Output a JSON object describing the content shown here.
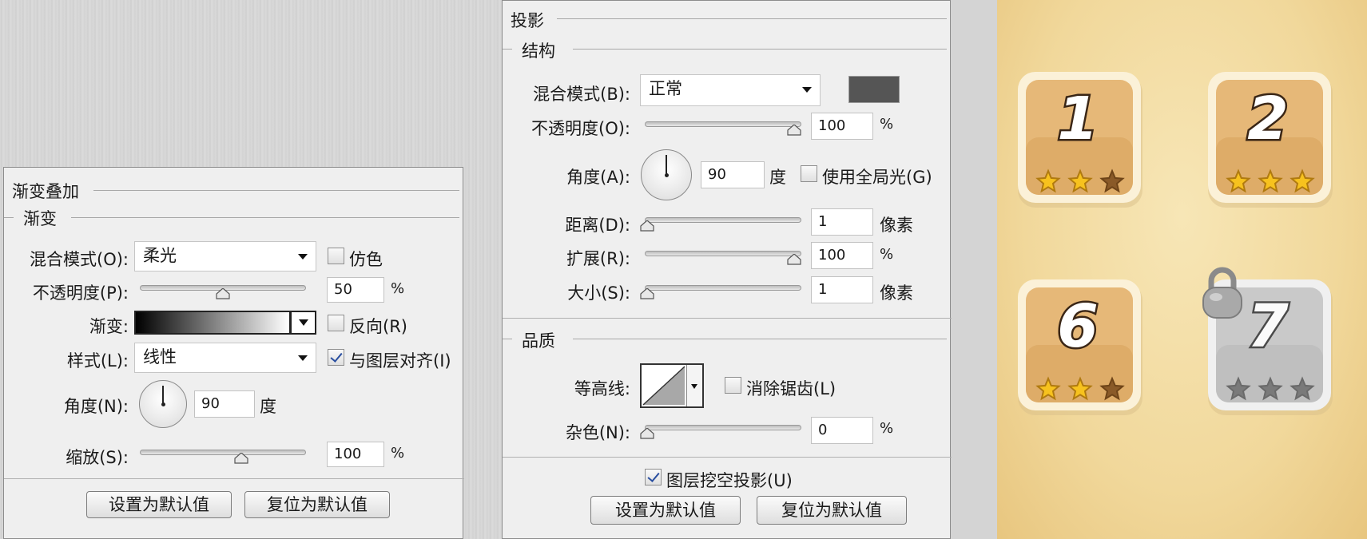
{
  "gradient_panel": {
    "section_title": "渐变叠加",
    "sub_title": "渐变",
    "blend_mode": {
      "label": "混合模式(O):",
      "value": "柔光"
    },
    "dither": {
      "label": "仿色",
      "checked": false
    },
    "opacity": {
      "label": "不透明度(P):",
      "value": "50",
      "unit": "%",
      "level": 0.5
    },
    "gradient": {
      "label": "渐变:"
    },
    "reverse": {
      "label": "反向(R)",
      "checked": false
    },
    "style": {
      "label": "样式(L):",
      "value": "线性"
    },
    "align": {
      "label": "与图层对齐(I)",
      "checked": true
    },
    "angle": {
      "label": "角度(N):",
      "value": "90",
      "unit": "度"
    },
    "scale": {
      "label": "缩放(S):",
      "value": "100",
      "unit": "%",
      "level": 0.6
    },
    "set_default": "设置为默认值",
    "reset_default": "复位为默认值"
  },
  "shadow_panel": {
    "section_title": "投影",
    "structure_title": "结构",
    "blend_mode": {
      "label": "混合模式(B):",
      "value": "正常",
      "color": "#555555"
    },
    "opacity": {
      "label": "不透明度(O):",
      "value": "100",
      "unit": "%",
      "level": 1.0
    },
    "angle": {
      "label": "角度(A):",
      "value": "90",
      "unit": "度"
    },
    "global_light": {
      "label": "使用全局光(G)",
      "checked": false
    },
    "distance": {
      "label": "距离(D):",
      "value": "1",
      "unit": "像素",
      "level": 0.0
    },
    "spread": {
      "label": "扩展(R):",
      "value": "100",
      "unit": "%",
      "level": 1.0
    },
    "size": {
      "label": "大小(S):",
      "value": "1",
      "unit": "像素",
      "level": 0.0
    },
    "quality_title": "品质",
    "contour": {
      "label": "等高线:"
    },
    "anti_alias": {
      "label": "消除锯齿(L)",
      "checked": false
    },
    "noise": {
      "label": "杂色(N):",
      "value": "0",
      "unit": "%",
      "level": 0.0
    },
    "knockout": {
      "label": "图层挖空投影(U)",
      "checked": true
    },
    "set_default": "设置为默认值",
    "reset_default": "复位为默认值"
  },
  "levels": [
    {
      "number": "1",
      "stars_earned": 2,
      "locked": false
    },
    {
      "number": "2",
      "stars_earned": 3,
      "locked": false
    },
    {
      "number": "6",
      "stars_earned": 2,
      "locked": false
    },
    {
      "number": "7",
      "stars_earned": 0,
      "locked": true
    }
  ]
}
